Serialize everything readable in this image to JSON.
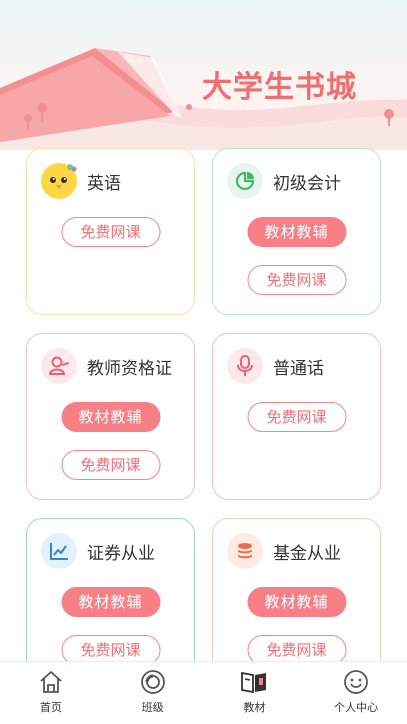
{
  "banner": {
    "title": "大学生书城"
  },
  "cards": [
    {
      "title": "英语",
      "icon": "chick-mascot-icon",
      "buttons": {
        "free": "免费网课"
      }
    },
    {
      "title": "初级会计",
      "icon": "pie-chart-icon",
      "buttons": {
        "material": "教材教辅",
        "free": "免费网课"
      }
    },
    {
      "title": "教师资格证",
      "icon": "teacher-icon",
      "buttons": {
        "material": "教材教辅",
        "free": "免费网课"
      }
    },
    {
      "title": "普通话",
      "icon": "microphone-icon",
      "buttons": {
        "free": "免费网课"
      }
    },
    {
      "title": "证券从业",
      "icon": "line-chart-icon",
      "buttons": {
        "material": "教材教辅",
        "free": "免费网课"
      }
    },
    {
      "title": "基金从业",
      "icon": "coin-stack-icon",
      "buttons": {
        "material": "教材教辅",
        "free": "免费网课"
      }
    }
  ],
  "tabbar": [
    {
      "label": "首页",
      "icon": "home-icon"
    },
    {
      "label": "班级",
      "icon": "class-icon"
    },
    {
      "label": "教材",
      "icon": "book-icon",
      "active": true
    },
    {
      "label": "个人中心",
      "icon": "smiley-icon"
    }
  ],
  "colors": {
    "accent": "#f77f86",
    "title": "#f26d6d",
    "blue_border": "#9fd0ee",
    "green_border": "#bfe5d2",
    "yellow_border": "#f7e3a6"
  }
}
